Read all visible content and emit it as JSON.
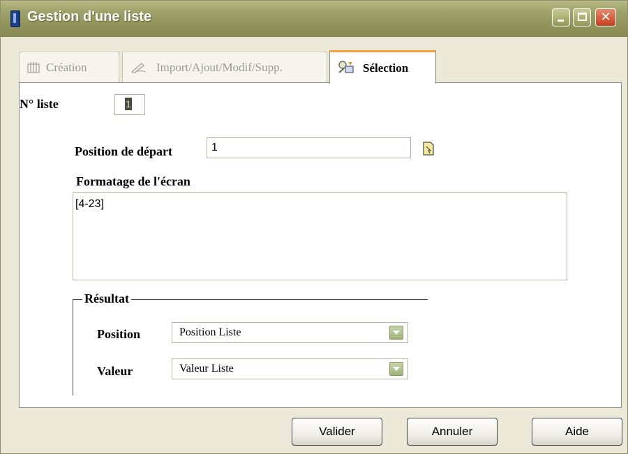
{
  "window": {
    "title": "Gestion d'une liste",
    "minimize": "",
    "maximize": "",
    "close": "✕"
  },
  "tabs": [
    {
      "label": "Création",
      "icon": "creation-icon",
      "state": "disabled"
    },
    {
      "label": "Import/Ajout/Modif/Supp.",
      "icon": "pen-icon",
      "state": "disabled"
    },
    {
      "label": "Sélection",
      "icon": "selection-icon",
      "state": "active"
    }
  ],
  "form": {
    "list_number_label": "N° liste",
    "list_number_value": "1",
    "start_position_label": "Position de départ",
    "start_position_value": "1",
    "screen_format_label": "Formatage de l'écran",
    "screen_format_value": "[4-23]",
    "result_group_label": "Résultat",
    "position_label": "Position",
    "position_value": "Position Liste",
    "value_label": "Valeur",
    "value_value": "Valeur Liste"
  },
  "buttons": {
    "validate": "Valider",
    "cancel": "Annuler",
    "help": "Aide"
  },
  "colors": {
    "titlebar": "#9fa26a",
    "active_tab_accent": "#f2a23b",
    "close_button": "#c4401e",
    "field_border": "#a9b8a4"
  }
}
